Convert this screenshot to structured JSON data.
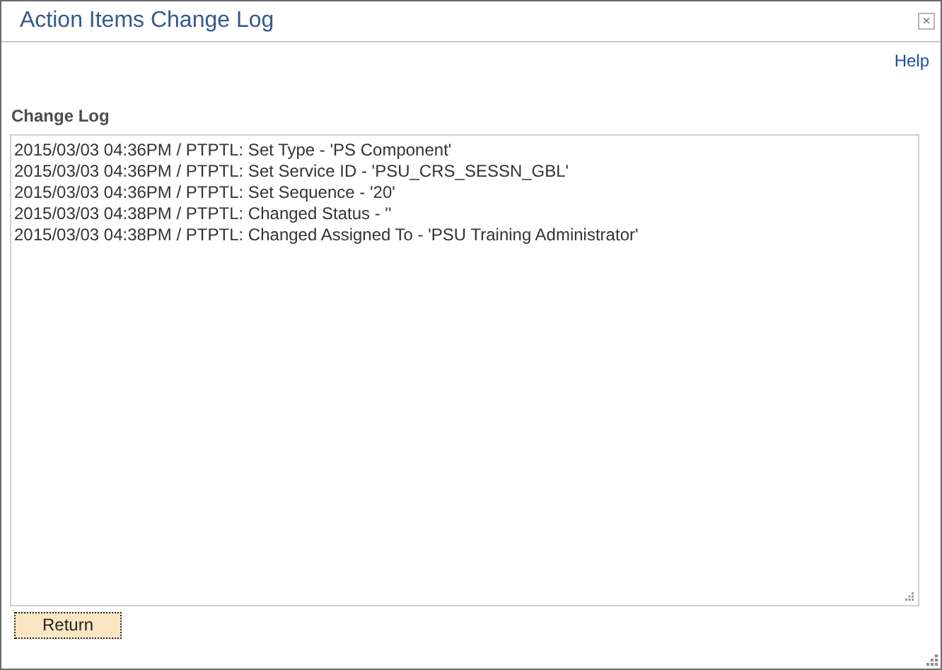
{
  "window": {
    "title": "Action Items Change Log",
    "close": "×"
  },
  "help_link": "Help",
  "change_log": {
    "label": "Change Log",
    "entries": [
      "2015/03/03 04:36PM / PTPTL: Set Type - 'PS Component'",
      "2015/03/03 04:36PM / PTPTL: Set Service ID - 'PSU_CRS_SESSN_GBL'",
      "2015/03/03 04:36PM / PTPTL: Set Sequence - '20'",
      "2015/03/03 04:38PM / PTPTL: Changed Status - ''",
      "2015/03/03 04:38PM / PTPTL: Changed Assigned To - 'PSU Training Administrator'"
    ]
  },
  "buttons": [
    "Return"
  ]
}
